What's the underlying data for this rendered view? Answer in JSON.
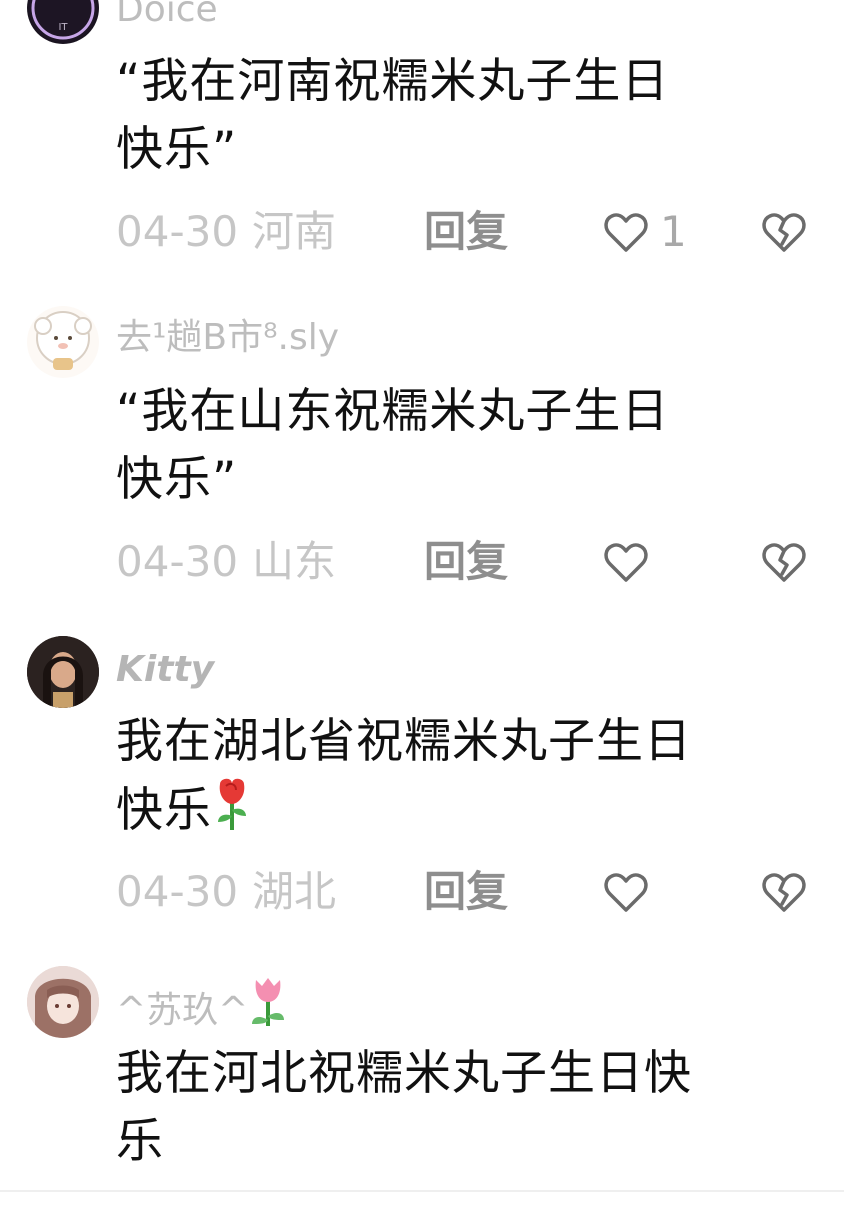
{
  "comments": [
    {
      "username": "Doice",
      "text_line1": "“我在河南祝糯米丸子生日",
      "text_line2": "快乐”",
      "date": "04-30",
      "location": "河南",
      "reply_label": "回复",
      "like_count": "1",
      "avatar_icon": "ring-avatar-icon"
    },
    {
      "username": "去¹趟B市⁸.sly",
      "text_line1": "“我在山东祝糯米丸子生日",
      "text_line2": "快乐”",
      "date": "04-30",
      "location": "山东",
      "reply_label": "回复",
      "like_count": "",
      "avatar_icon": "sheep-avatar-icon"
    },
    {
      "username": "Kitty",
      "text_line1": "我在湖北省祝糯米丸子生日",
      "text_line2": "快乐",
      "text_emoji": "rose-emoji",
      "date": "04-30",
      "location": "湖北",
      "reply_label": "回复",
      "like_count": "",
      "avatar_icon": "girl-avatar-icon"
    },
    {
      "username": "^苏玖^",
      "username_emoji": "tulip-emoji",
      "text_line1": "我在河北祝糯米丸子生日快",
      "text_line2": "乐",
      "avatar_icon": "anime-avatar-icon"
    }
  ],
  "colors": {
    "meta_gray": "#c6c6c6",
    "reply_gray": "#8e8e8e",
    "icon_gray": "#6b6b6b"
  }
}
